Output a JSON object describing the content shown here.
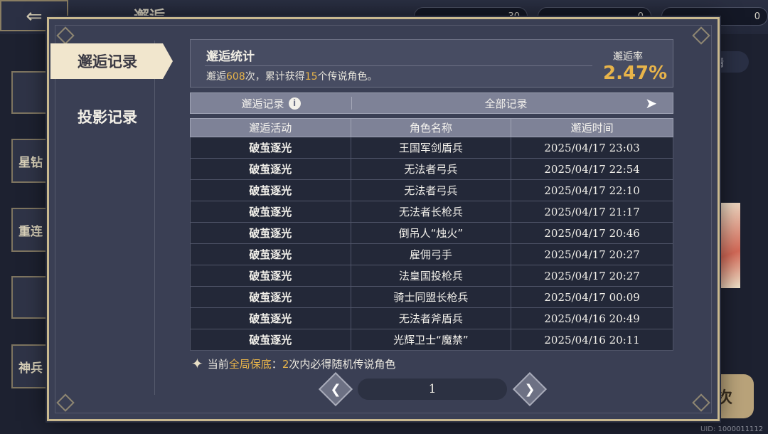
{
  "background": {
    "title": "邂逅",
    "resources": [
      "30",
      "0",
      "0"
    ],
    "left_cards": [
      "星钻",
      "重连",
      "神兵"
    ],
    "right_pill": "情",
    "right_button": "次",
    "uid": "UID: 1000011112"
  },
  "sidebar": {
    "tabs": [
      {
        "label": "邂逅记录",
        "active": true
      },
      {
        "label": "投影记录",
        "active": false
      }
    ]
  },
  "stats": {
    "title": "邂逅统计",
    "desc_prefix": "邂逅",
    "total_count": "608",
    "desc_middle": "次，累计获得",
    "legendary_count": "15",
    "desc_suffix": "个传说角色。",
    "rate_label": "邂逅率",
    "rate_value": "2.47%"
  },
  "filter": {
    "label": "邂逅记录",
    "value": "全部记录"
  },
  "table": {
    "headers": [
      "邂逅活动",
      "角色名称",
      "邂逅时间"
    ],
    "rows": [
      [
        "破茧逐光",
        "王国军剑盾兵",
        "2025/04/17 23:03"
      ],
      [
        "破茧逐光",
        "无法者弓兵",
        "2025/04/17 22:54"
      ],
      [
        "破茧逐光",
        "无法者弓兵",
        "2025/04/17 22:10"
      ],
      [
        "破茧逐光",
        "无法者长枪兵",
        "2025/04/17 21:17"
      ],
      [
        "破茧逐光",
        "倒吊人“烛火”",
        "2025/04/17 20:46"
      ],
      [
        "破茧逐光",
        "雇佣弓手",
        "2025/04/17 20:27"
      ],
      [
        "破茧逐光",
        "法皇国投枪兵",
        "2025/04/17 20:27"
      ],
      [
        "破茧逐光",
        "骑士同盟长枪兵",
        "2025/04/17 00:09"
      ],
      [
        "破茧逐光",
        "无法者斧盾兵",
        "2025/04/16 20:49"
      ],
      [
        "破茧逐光",
        "光辉卫士“魔禁”",
        "2025/04/16 20:11"
      ]
    ]
  },
  "guarantee": {
    "prefix": "当前",
    "highlight": "全局保底",
    "colon": "：",
    "count": "2",
    "suffix": "次内必得随机传说角色"
  },
  "pager": {
    "page": "1"
  },
  "colors": {
    "accent": "#e8b44a",
    "panel": "#3a3f54",
    "border_gold": "#c9b98f"
  }
}
